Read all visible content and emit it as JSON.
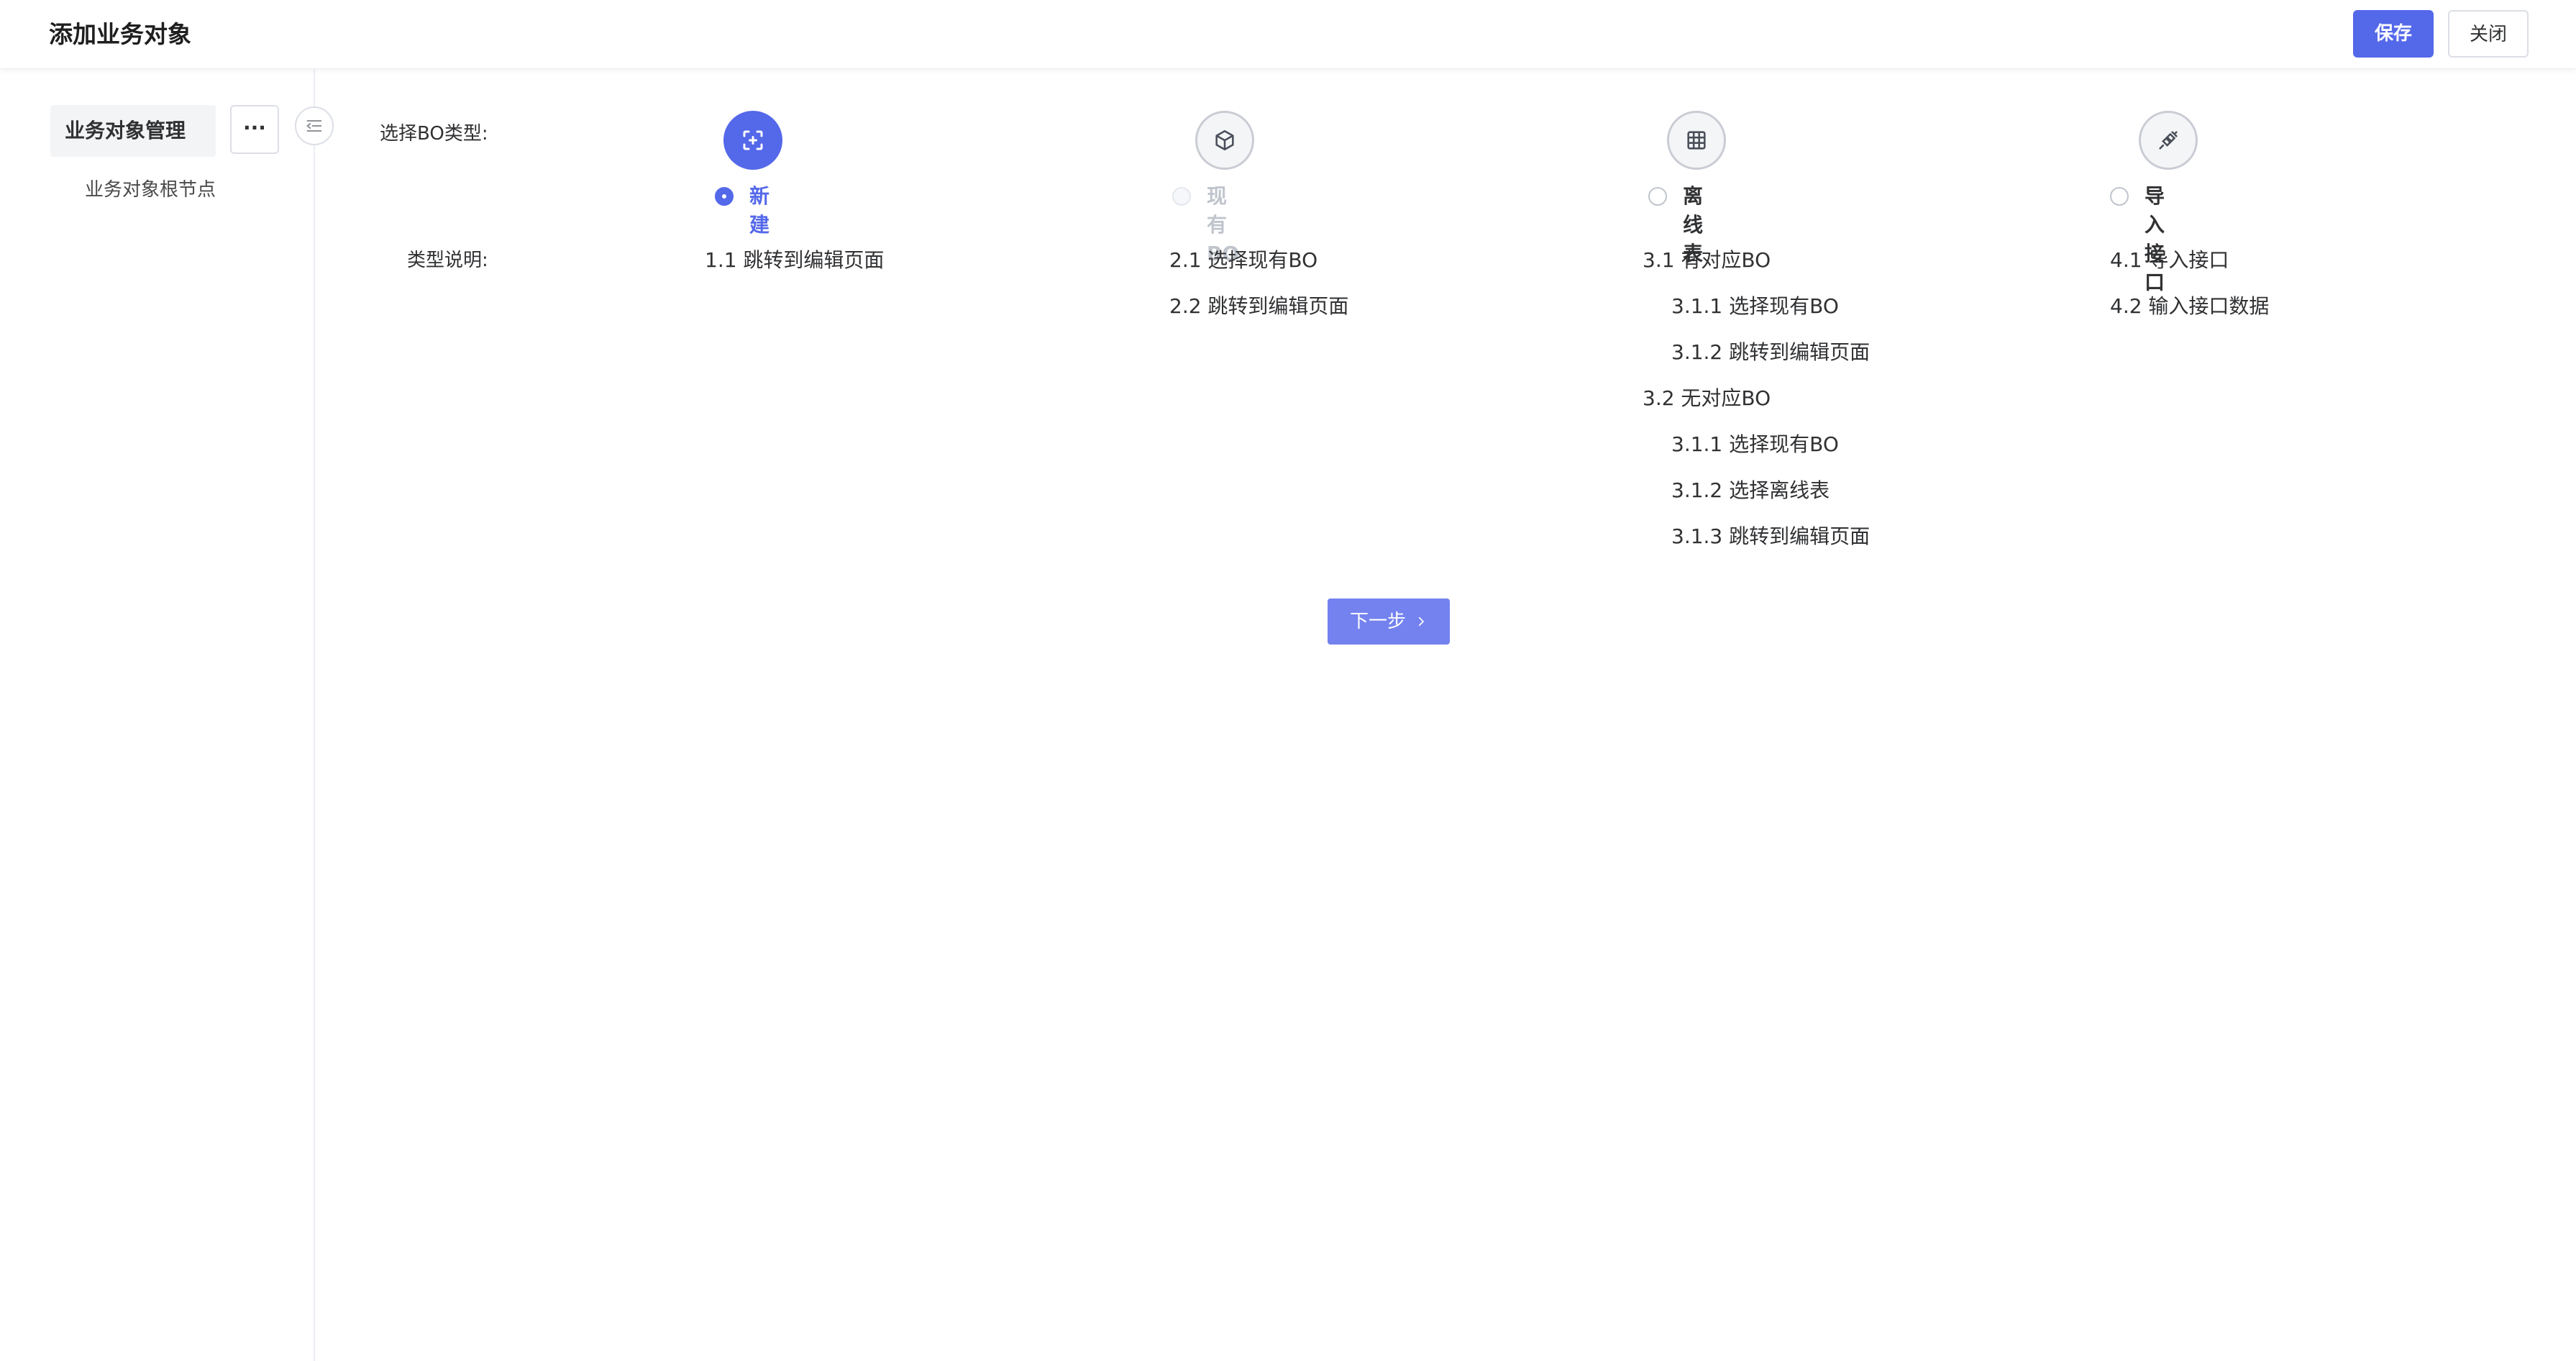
{
  "header": {
    "title": "添加业务对象",
    "save_label": "保存",
    "close_label": "关闭"
  },
  "sidebar": {
    "root_label": "业务对象管理",
    "more_label": "···",
    "child_label": "业务对象根节点"
  },
  "form": {
    "type_label": "选择BO类型:",
    "desc_label": "类型说明:",
    "types": [
      {
        "label": "新建",
        "state": "checked",
        "icon": "scan-plus-icon",
        "desc": [
          {
            "text": "1.1 跳转到编辑页面",
            "indent": 0
          }
        ]
      },
      {
        "label": "现有BO",
        "state": "disabled",
        "icon": "cube-icon",
        "desc": [
          {
            "text": "2.1 选择现有BO",
            "indent": 0
          },
          {
            "text": "2.2 跳转到编辑页面",
            "indent": 0
          }
        ]
      },
      {
        "label": "离线表",
        "state": "normal",
        "icon": "table-icon",
        "desc": [
          {
            "text": "3.1 有对应BO",
            "indent": 0
          },
          {
            "text": "3.1.1 选择现有BO",
            "indent": 1
          },
          {
            "text": "3.1.2 跳转到编辑页面",
            "indent": 1
          },
          {
            "text": "3.2 无对应BO",
            "indent": 0
          },
          {
            "text": "3.1.1 选择现有BO",
            "indent": 1
          },
          {
            "text": "3.1.2 选择离线表",
            "indent": 1
          },
          {
            "text": "3.1.3 跳转到编辑页面",
            "indent": 1
          }
        ]
      },
      {
        "label": "导入接口",
        "state": "normal",
        "icon": "plug-icon",
        "desc": [
          {
            "text": "4.1 导入接口",
            "indent": 0
          },
          {
            "text": "4.2 输入接口数据",
            "indent": 0
          }
        ]
      }
    ],
    "next_label": "下一步"
  },
  "colors": {
    "primary": "#5468ea",
    "next_button": "#7382ee",
    "disabled_text": "#c0c4cc"
  }
}
